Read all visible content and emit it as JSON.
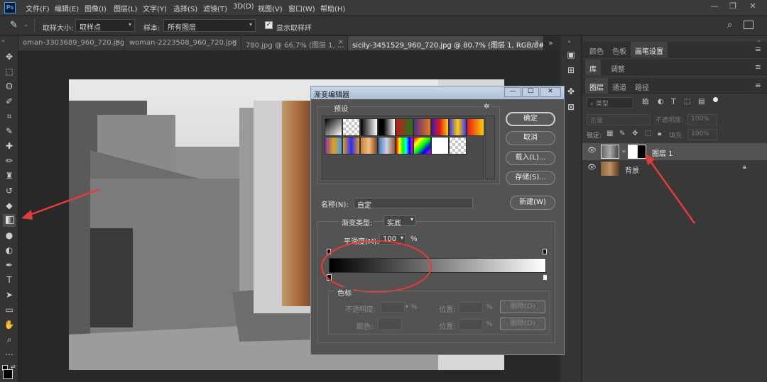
{
  "app": {
    "logo": "Ps"
  },
  "menu": [
    "文件(F)",
    "编辑(E)",
    "图像(I)",
    "图层(L)",
    "文字(Y)",
    "选择(S)",
    "滤镜(T)",
    "3D(D)",
    "视图(V)",
    "窗口(W)",
    "帮助(H)"
  ],
  "window_controls": [
    "—",
    "❐",
    "✕"
  ],
  "options_bar": {
    "tool_icon": "eyedropper-icon",
    "sample_size_label": "取样大小:",
    "sample_size_value": "取样点",
    "sample_label": "样本:",
    "sample_value": "所有图层",
    "show_ring_label": "显示取样环",
    "show_ring_checked": true
  },
  "tabs": [
    {
      "label": "oman-3303689_960_720.jpg",
      "active": false
    },
    {
      "label": "woman-2223508_960_720.jpg",
      "active": false
    },
    {
      "label": "780.jpg @ 66.7% (图层 1, ...",
      "active": false
    },
    {
      "label": "sicily-3451529_960_720.jpg @ 80.7% (图层 1, RGB/8#) *",
      "active": true
    }
  ],
  "tabs_overflow": "»",
  "toolbar": {
    "tools": [
      "move-icon",
      "marquee-icon",
      "lasso-icon",
      "quick-select-icon",
      "crop-icon",
      "eyedropper-icon",
      "healing-icon",
      "brush-icon",
      "stamp-icon",
      "history-brush-icon",
      "eraser-icon",
      "gradient-icon",
      "blur-icon",
      "dodge-icon",
      "pen-icon",
      "type-icon",
      "path-select-icon",
      "rectangle-icon",
      "hand-icon",
      "zoom-icon",
      "more-icon"
    ],
    "selected_tool": "gradient-icon"
  },
  "right_panel": {
    "top_tabs": [
      "颜色",
      "色板",
      "画笔设置"
    ],
    "top_tabs_active": 2,
    "lib_tabs": [
      "库",
      "调整"
    ],
    "lib_tabs_active": 0,
    "layer_tabs": [
      "图层",
      "通道",
      "路径"
    ],
    "layer_tabs_active": 0,
    "search_placeholder": "类型",
    "blend_mode": "正常",
    "opacity_label": "不透明度:",
    "opacity_value": "100%",
    "lock_label": "锁定:",
    "fill_label": "填充:",
    "fill_value": "100%",
    "layers": [
      {
        "name": "图层 1",
        "has_mask": true,
        "selected": true,
        "locked": false
      },
      {
        "name": "背景",
        "has_mask": false,
        "selected": false,
        "locked": true
      }
    ]
  },
  "dialog": {
    "title": "渐变编辑器",
    "presets_label": "预设",
    "buttons": {
      "ok": "确定",
      "cancel": "取消",
      "load": "载入(L)...",
      "save": "存储(S)...",
      "new": "新建(W)"
    },
    "name_label": "名称(N):",
    "name_value": "自定",
    "type_label": "渐变类型:",
    "type_value": "实底",
    "smooth_label": "平滑度(M):",
    "smooth_value": "100",
    "smooth_unit": "%",
    "stops_section": "色标",
    "opacity_label": "不透明度:",
    "opacity_unit": "%",
    "location_label": "位置:",
    "location_unit": "%",
    "delete_label": "删除(D)",
    "color_label": "颜色:",
    "location2_label": "位置:",
    "location2_unit": "%",
    "delete2_label": "删除(D)",
    "gradient_start_color": "#000000",
    "gradient_end_color": "#ffffff",
    "presets": [
      "linear-gradient(135deg,#000,#fff)",
      "checker",
      "linear-gradient(90deg,#000,#fff)",
      "linear-gradient(90deg,#000,#000 30%,#fff)",
      "linear-gradient(90deg,#c41a1a,#1d7a1d)",
      "linear-gradient(90deg,#5a2a8a,#e47a1a)",
      "linear-gradient(90deg,#3a1ab0,#e41a1a,#ffd000)",
      "linear-gradient(90deg,#3a3aff,#ffd000,#3a3aff)",
      "linear-gradient(90deg,#e41a1a,#ffd000)",
      "linear-gradient(90deg,#7a3ab0,#e4a01a,#3aa0e4)",
      "linear-gradient(90deg,#e4a01a,#2a2aff,#e4a01a)",
      "linear-gradient(90deg,#c7803a,#f0c080,#804020)",
      "linear-gradient(90deg,#3a7ab0,#d0d0e0,#8a5a3a)",
      "linear-gradient(90deg,#ff0000,#ffff00,#00ff00,#00ffff,#0000ff,#ff00ff)",
      "linear-gradient(135deg,#ff0000,#ffff00,#00ff00,#0000ff,#ff00ff)",
      "linear-gradient(90deg,#ffffff,#ffffff)",
      "checker"
    ]
  }
}
